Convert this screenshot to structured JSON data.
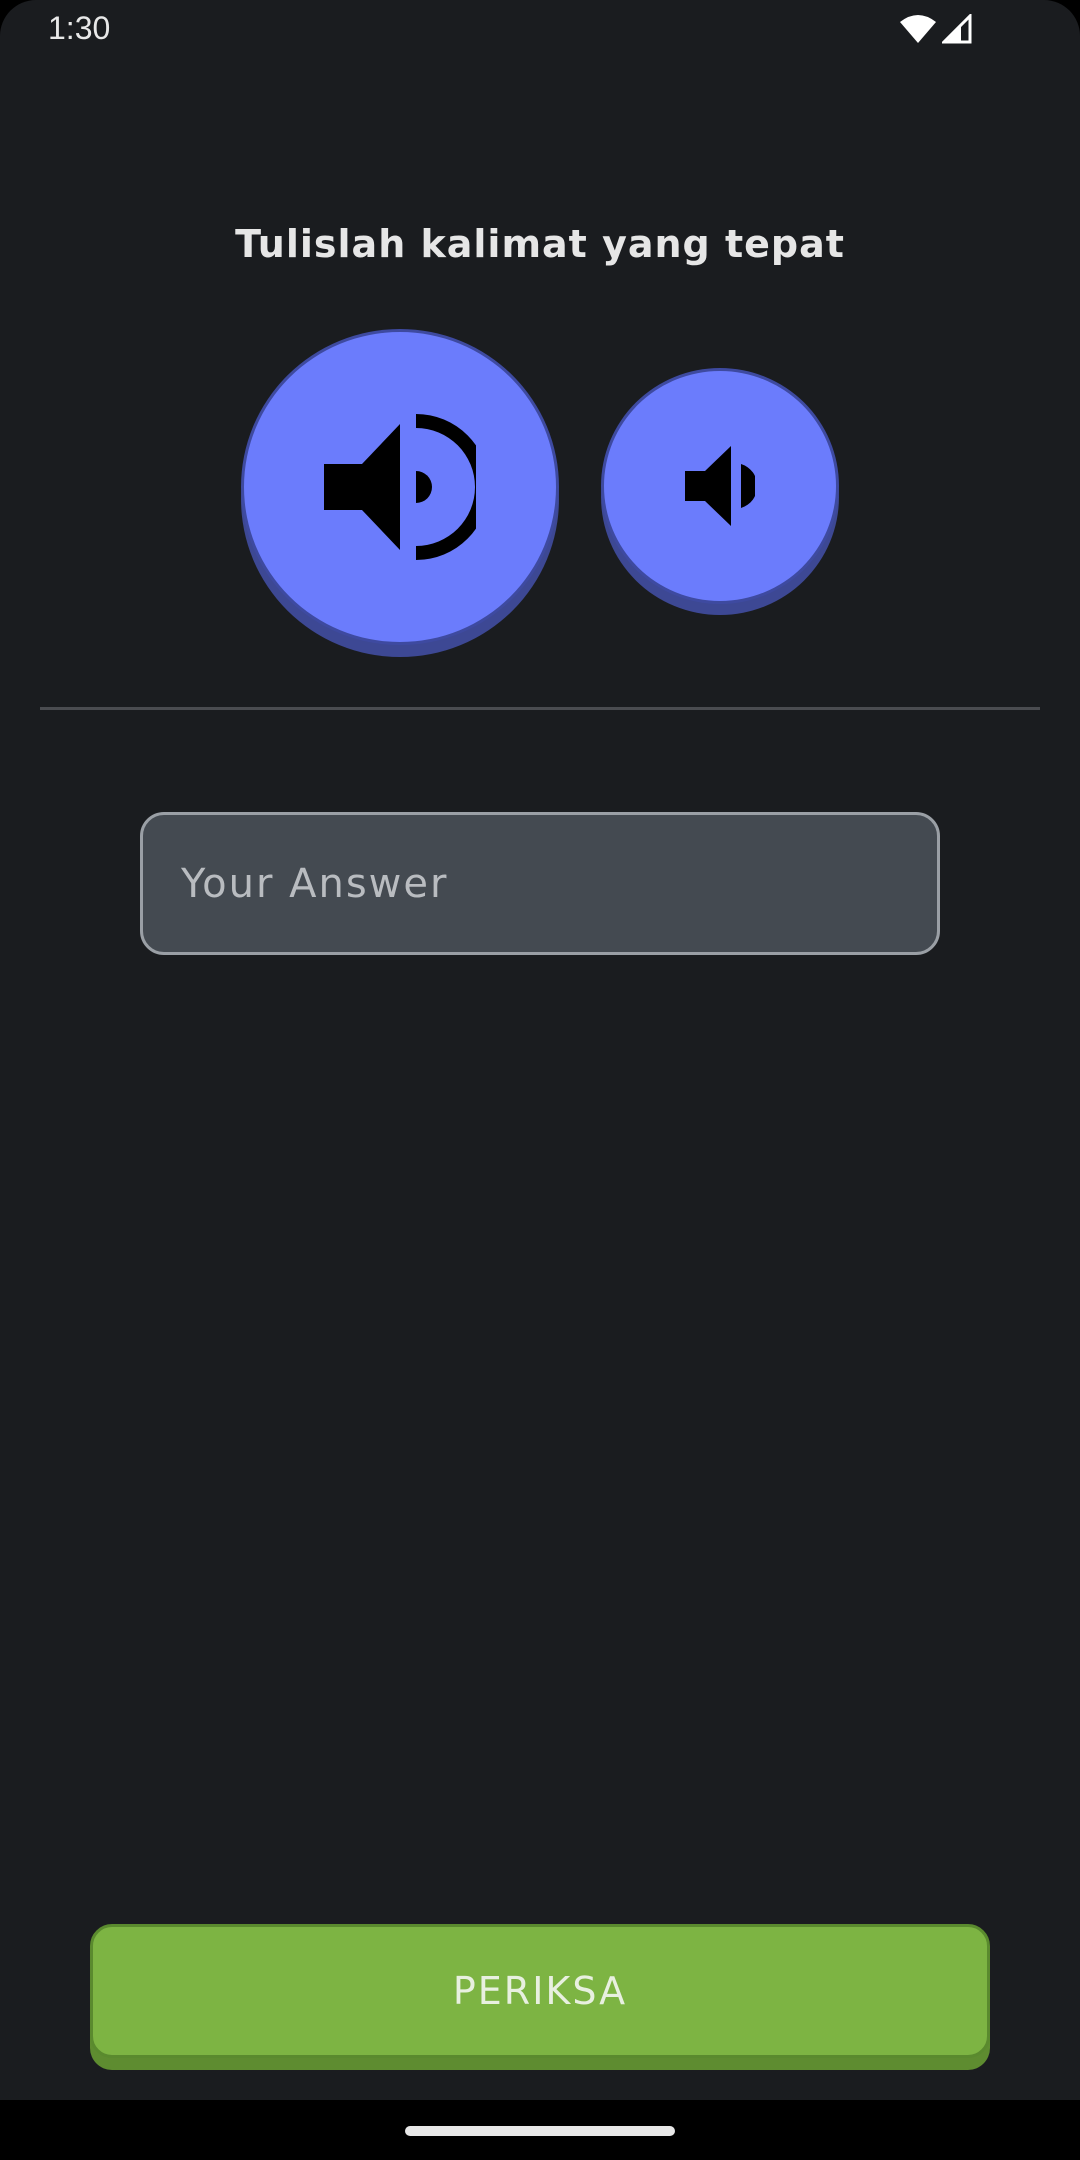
{
  "status_bar": {
    "time": "1:30",
    "icons": [
      "wifi-icon",
      "cellular-signal-icon"
    ]
  },
  "exercise": {
    "instruction": "Tulislah kalimat yang tepat",
    "audio_buttons": [
      {
        "name": "play-audio-normal-button",
        "icon": "speaker-loud-icon"
      },
      {
        "name": "play-audio-slow-button",
        "icon": "speaker-quiet-icon"
      }
    ],
    "answer_field": {
      "value": "",
      "placeholder": "Your Answer"
    },
    "check_button_label": "PERIKSA"
  },
  "colors": {
    "background": "#1a1c1f",
    "audio_button": "#6b7cfc",
    "audio_button_shadow": "#3d4894",
    "input_background": "#444a51",
    "check_button": "#7db443"
  }
}
